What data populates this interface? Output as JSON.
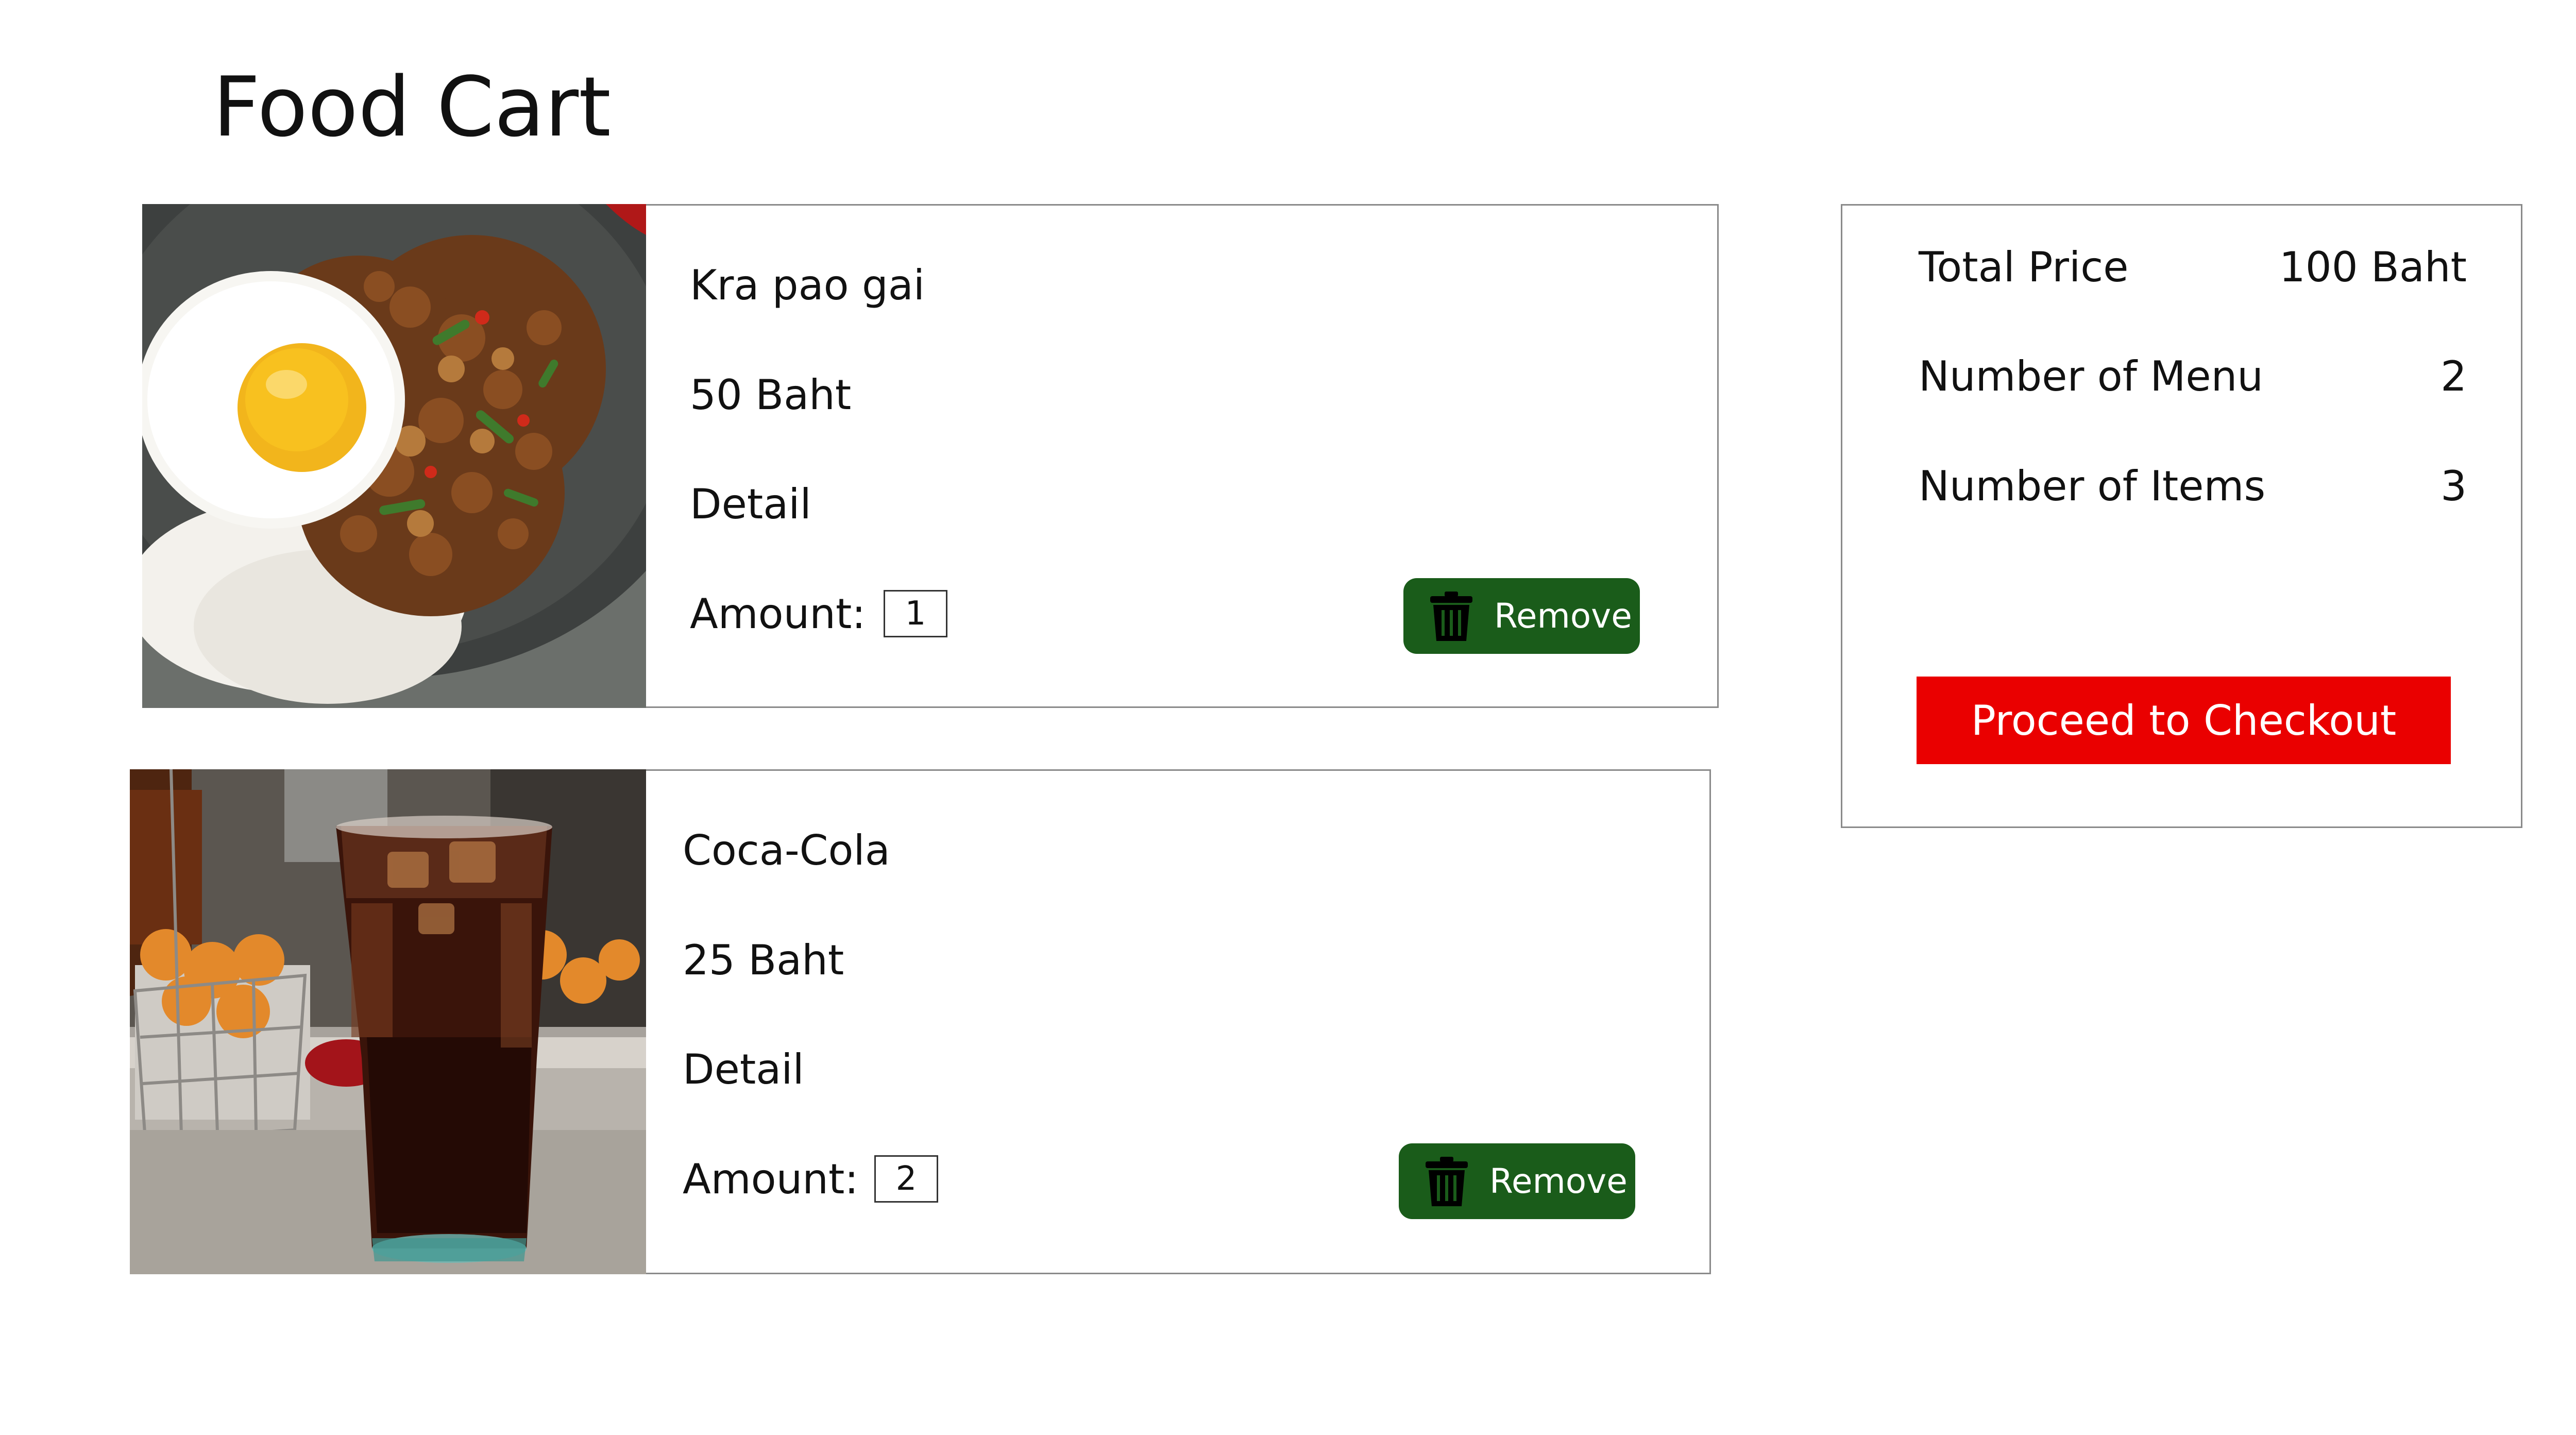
{
  "page": {
    "title": "Food Cart"
  },
  "cart": {
    "items": [
      {
        "name": "Kra pao gai",
        "price": "50 Baht",
        "detail": "Detail",
        "amount_label": "Amount:",
        "amount": "1",
        "remove_label": "Remove",
        "image": "kra-pao-gai-photo"
      },
      {
        "name": "Coca-Cola",
        "price": "25 Baht",
        "detail": "Detail",
        "amount_label": "Amount:",
        "amount": "2",
        "remove_label": "Remove",
        "image": "coca-cola-photo"
      }
    ]
  },
  "summary": {
    "total_price_label": "Total Price",
    "total_price_value": "100 Baht",
    "menu_count_label": "Number of Menu",
    "menu_count_value": "2",
    "item_count_label": "Number of Items",
    "item_count_value": "3",
    "checkout_label": "Proceed to Checkout"
  },
  "colors": {
    "remove_button": "#1a5c1a",
    "checkout_button": "#ea0000",
    "card_border": "#8a8a8a"
  },
  "icons": {
    "remove": "trash-icon"
  }
}
